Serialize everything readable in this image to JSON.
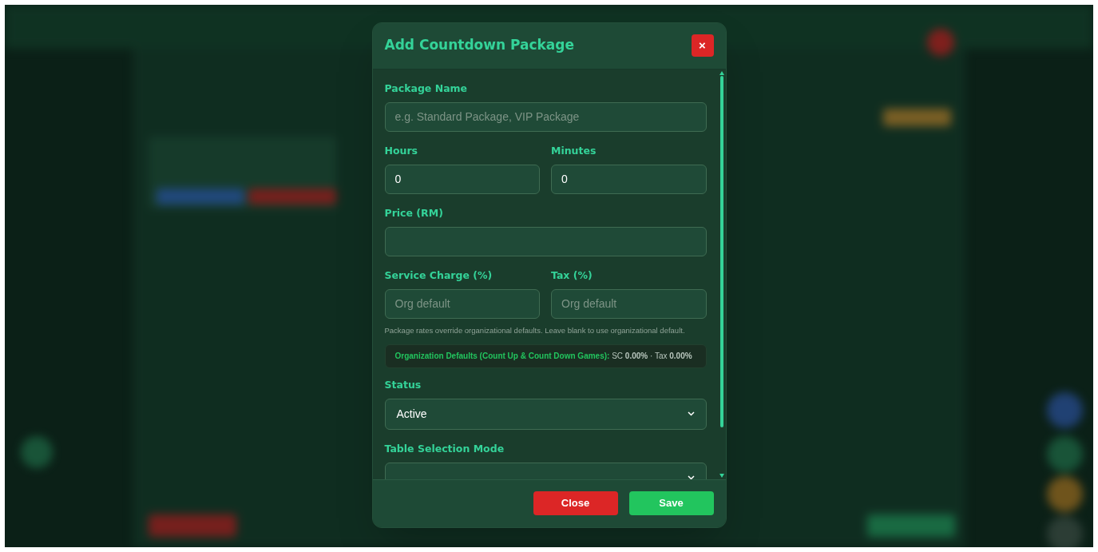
{
  "dialog": {
    "title": "Add Countdown Package",
    "close_icon": "×",
    "fields": [
      {
        "kind": "text",
        "label": "Package Name",
        "placeholder": "e.g. Standard Package, VIP Package"
      },
      {
        "kind": "pair",
        "items": [
          {
            "label": "Hours",
            "value": "0"
          },
          {
            "label": "Minutes",
            "value": "0"
          }
        ]
      },
      {
        "kind": "text",
        "label": "Price (RM)"
      },
      {
        "kind": "pair",
        "items": [
          {
            "label": "Service Charge (%)",
            "placeholder": "Org default"
          },
          {
            "label": "Tax (%)",
            "placeholder": "Org default"
          }
        ]
      },
      {
        "kind": "hint",
        "text": "Package rates override organizational defaults. Leave blank to use organizational default."
      },
      {
        "kind": "note",
        "label": "Organization Defaults (Count Up & Count Down Games):",
        "text": "SC **0.00%** · Tax **0.00%**"
      },
      {
        "kind": "select",
        "label": "Status",
        "value": "Active"
      },
      {
        "kind": "select",
        "label": "Table Selection Mode"
      }
    ],
    "buttons": [
      {
        "kind": "close",
        "label": "Close"
      },
      {
        "kind": "save",
        "label": "Save"
      }
    ]
  }
}
